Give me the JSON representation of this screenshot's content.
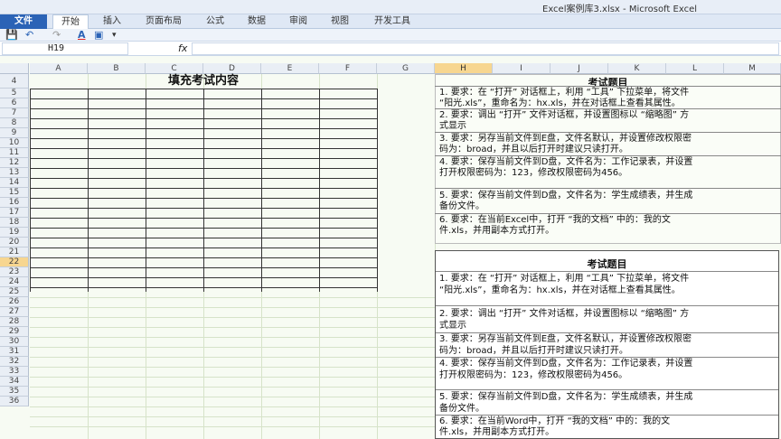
{
  "window": {
    "title": "Excel案例库3.xlsx - Microsoft Excel"
  },
  "ribbon": {
    "tabs": [
      {
        "label": "文件"
      },
      {
        "label": "开始"
      },
      {
        "label": "插入"
      },
      {
        "label": "页面布局"
      },
      {
        "label": "公式"
      },
      {
        "label": "数据"
      },
      {
        "label": "审阅"
      },
      {
        "label": "视图"
      },
      {
        "label": "开发工具"
      }
    ],
    "active_tab": "开始"
  },
  "quick_access": {
    "icons": [
      "save-icon",
      "undo-icon",
      "redo-icon",
      "font-color-icon",
      "camera-icon",
      "customize-icon"
    ]
  },
  "formula_bar": {
    "name_box": "H19",
    "fx_label": "fx",
    "formula": ""
  },
  "grid": {
    "columns": [
      "A",
      "B",
      "C",
      "D",
      "E",
      "F",
      "G",
      "H",
      "I",
      "J",
      "K",
      "L",
      "M"
    ],
    "selected_column": "H",
    "rows": [
      "4",
      "5",
      "6",
      "7",
      "8",
      "9",
      "10",
      "11",
      "12",
      "13",
      "14",
      "15",
      "16",
      "17",
      "18",
      "19",
      "20",
      "21",
      "22",
      "23",
      "24",
      "25",
      "26",
      "27",
      "28",
      "29",
      "30",
      "31",
      "32",
      "33",
      "34",
      "35",
      "36"
    ],
    "selected_row": "19"
  },
  "left_table": {
    "title": "填充考试内容"
  },
  "panel_top": {
    "title": "考试题目",
    "items": [
      "1. 要求：在 “打开” 对话框上，利用 “工具” 下拉菜单，将文件",
      "“阳光.xls”，重命名为：hx.xls，并在对话框上查看其属性。",
      "2. 要求：调出 “打开” 文件对话框，并设置图标以 “缩略图” 方",
      "式显示",
      "3. 要求：另存当前文件到E盘，文件名默认，并设置修改权限密",
      "码为：broad，并且以后打开时建议只读打开。",
      "4. 要求：保存当前文件到D盘，文件名为：工作记录表，并设置",
      "打开权限密码为：123，修改权限密码为456。",
      "5. 要求：保存当前文件到D盘，文件名为：学生成绩表，并生成",
      "备份文件。",
      "6. 要求：在当前Excel中，打开 “我的文档” 中的：我的文",
      "件.xls，并用副本方式打开。"
    ]
  },
  "panel_bottom": {
    "title": "考试题目",
    "items": [
      "1. 要求：在 “打开” 对话框上，利用 “工具” 下拉菜单，将文件",
      "“阳光.xls”，重命名为：hx.xls，并在对话框上查看其属性。",
      "2. 要求：调出 “打开” 文件对话框，并设置图标以 “缩略图” 方",
      "式显示",
      "3. 要求：另存当前文件到E盘，文件名默认，并设置修改权限密",
      "码为：broad，并且以后打开时建议只读打开。",
      "4. 要求：保存当前文件到D盘，文件名为：工作记录表，并设置",
      "打开权限密码为：123，修改权限密码为456。",
      "5. 要求：保存当前文件到D盘，文件名为：学生成绩表，并生成",
      "备份文件。",
      "6. 要求：在当前Word中，打开 “我的文档” 中的：我的文",
      "件.xls，并用副本方式打开。"
    ]
  },
  "colors": {
    "file_tab": "#2b63b6",
    "selection": "#f7d690",
    "grid_bg": "#f7fbf3"
  }
}
